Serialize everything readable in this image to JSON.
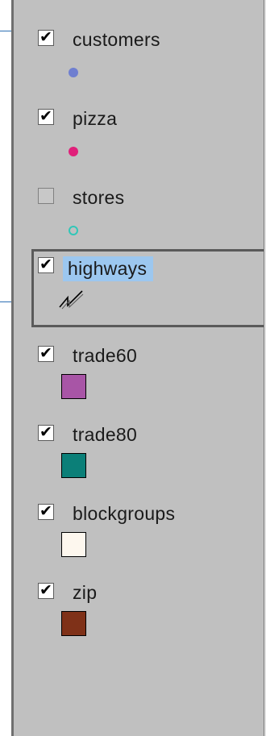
{
  "legend": {
    "layers": [
      {
        "name": "customers",
        "checked": true,
        "symbol": "dot",
        "color": "#6f7fd0"
      },
      {
        "name": "pizza",
        "checked": true,
        "symbol": "dot",
        "color": "#e0207a"
      },
      {
        "name": "stores",
        "checked": false,
        "symbol": "hollow-dot",
        "color": "#31c7b8"
      },
      {
        "name": "highways",
        "checked": true,
        "selected": true,
        "symbol": "line",
        "color": "#000000"
      },
      {
        "name": "trade60",
        "checked": true,
        "symbol": "swatch",
        "color": "#a855a6"
      },
      {
        "name": "trade80",
        "checked": true,
        "symbol": "swatch",
        "color": "#0b7f78"
      },
      {
        "name": "blockgroups",
        "checked": true,
        "symbol": "swatch",
        "color": "#fdf7ee"
      },
      {
        "name": "zip",
        "checked": true,
        "symbol": "swatch",
        "color": "#7f3118"
      }
    ]
  },
  "ui": {
    "check_mark": "✔",
    "accent_line": "#2d6fb4",
    "selection_highlight": "#9cc7ef",
    "panel_bg": "#c0c0c0"
  }
}
